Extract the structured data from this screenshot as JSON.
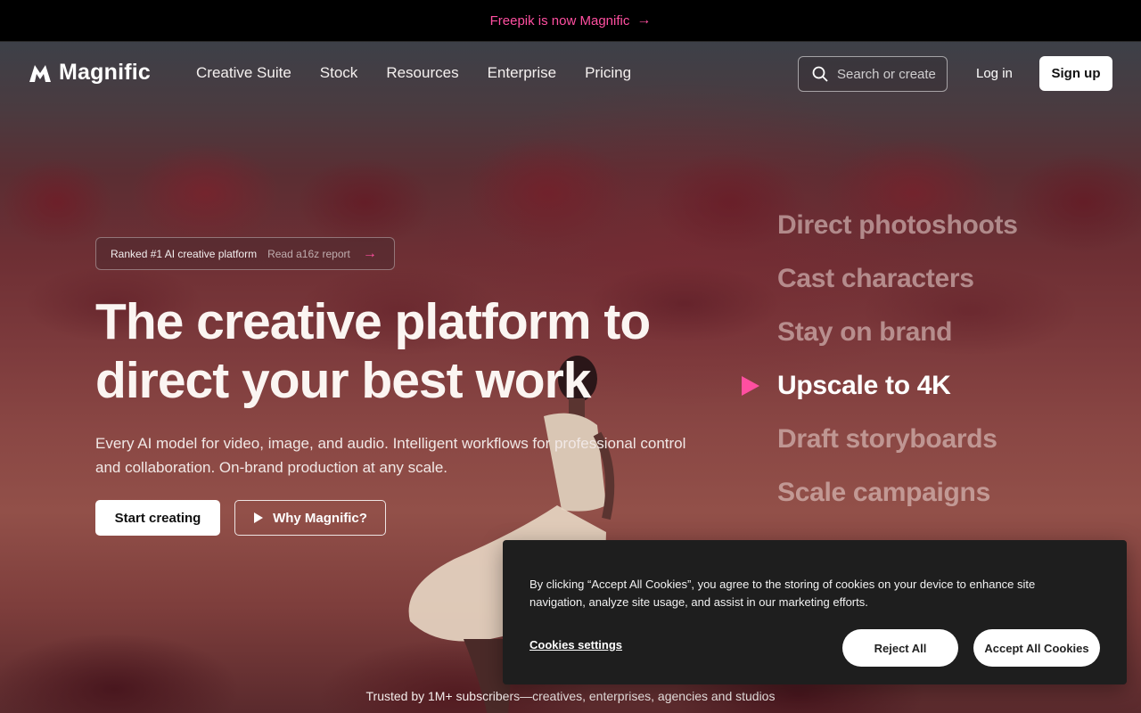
{
  "announcement": {
    "text": "Freepik is now Magnific",
    "arrow": "→"
  },
  "brand": {
    "name": "Magnific",
    "accent": "#ff4fa0"
  },
  "nav": {
    "links": [
      "Creative Suite",
      "Stock",
      "Resources",
      "Enterprise",
      "Pricing"
    ],
    "search_placeholder": "Search or create",
    "login": "Log in",
    "signup": "Sign up"
  },
  "hero": {
    "badge_label": "Ranked #1 AI creative platform",
    "badge_link": "Read a16z report",
    "badge_arrow": "→",
    "headline": "The creative platform to direct your best work",
    "subheadline": "Every AI model for video, image, and audio. Intelligent workflows for professional control and collaboration. On-brand production at any scale.",
    "primary_cta": "Start creating",
    "secondary_cta": "Why Magnific?"
  },
  "features": {
    "items": [
      "Direct photoshoots",
      "Cast characters",
      "Stay on brand",
      "Upscale to 4K",
      "Draft storyboards",
      "Scale campaigns"
    ],
    "active_index": 3
  },
  "trusted": "Trusted by 1M+ subscribers—creatives, enterprises, agencies and studios",
  "cookie": {
    "message": "By clicking “Accept All Cookies”, you agree to the storing of cookies on your device to enhance site navigation, analyze site usage, and assist in our marketing efforts.",
    "settings": "Cookies settings",
    "reject": "Reject All",
    "accept": "Accept All Cookies"
  }
}
